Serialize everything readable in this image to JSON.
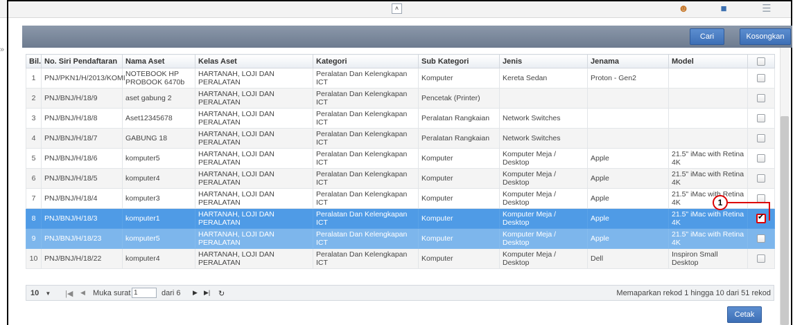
{
  "toolbar": {
    "collapse_icon": "chevrons-up-icon",
    "icons": [
      "user-settings-icon",
      "save-disk-icon",
      "list-view-icon",
      "exit-icon"
    ]
  },
  "search": {
    "cari_label": "Cari",
    "kosongkan_label": "Kosongkan"
  },
  "table": {
    "columns": [
      "Bil.",
      "No. Siri Pendaftaran",
      "Nama Aset",
      "Kelas Aset",
      "Kategori",
      "Sub Kategori",
      "Jenis",
      "Jenama",
      "Model"
    ],
    "rows": [
      {
        "bil": "1",
        "siri": "PNJ/PKN1/H/2013/KOMI",
        "nama": "NOTEBOOK HP PROBOOK 6470b",
        "kelas": "HARTANAH, LOJI DAN PERALATAN",
        "kategori": "Peralatan Dan Kelengkapan ICT",
        "sub": "Komputer",
        "jenis": "Kereta Sedan",
        "jenama": "Proton - Gen2",
        "model": "",
        "checked": false
      },
      {
        "bil": "2",
        "siri": "PNJ/BNJ/H/18/9",
        "nama": "aset gabung 2",
        "kelas": "HARTANAH, LOJI DAN PERALATAN",
        "kategori": "Peralatan Dan Kelengkapan ICT",
        "sub": "Pencetak (Printer)",
        "jenis": "",
        "jenama": "",
        "model": "",
        "checked": false
      },
      {
        "bil": "3",
        "siri": "PNJ/BNJ/H/18/8",
        "nama": "Aset12345678",
        "kelas": "HARTANAH, LOJI DAN PERALATAN",
        "kategori": "Peralatan Dan Kelengkapan ICT",
        "sub": "Peralatan Rangkaian",
        "jenis": "Network Switches",
        "jenama": "",
        "model": "",
        "checked": false
      },
      {
        "bil": "4",
        "siri": "PNJ/BNJ/H/18/7",
        "nama": "GABUNG 18",
        "kelas": "HARTANAH, LOJI DAN PERALATAN",
        "kategori": "Peralatan Dan Kelengkapan ICT",
        "sub": "Peralatan Rangkaian",
        "jenis": "Network Switches",
        "jenama": "",
        "model": "",
        "checked": false
      },
      {
        "bil": "5",
        "siri": "PNJ/BNJ/H/18/6",
        "nama": "komputer5",
        "kelas": "HARTANAH, LOJI DAN PERALATAN",
        "kategori": "Peralatan Dan Kelengkapan ICT",
        "sub": "Komputer",
        "jenis": "Komputer Meja / Desktop",
        "jenama": "Apple",
        "model": "21.5\" iMac with Retina 4K",
        "checked": false
      },
      {
        "bil": "6",
        "siri": "PNJ/BNJ/H/18/5",
        "nama": "komputer4",
        "kelas": "HARTANAH, LOJI DAN PERALATAN",
        "kategori": "Peralatan Dan Kelengkapan ICT",
        "sub": "Komputer",
        "jenis": "Komputer Meja / Desktop",
        "jenama": "Apple",
        "model": "21.5\" iMac with Retina 4K",
        "checked": false
      },
      {
        "bil": "7",
        "siri": "PNJ/BNJ/H/18/4",
        "nama": "komputer3",
        "kelas": "HARTANAH, LOJI DAN PERALATAN",
        "kategori": "Peralatan Dan Kelengkapan ICT",
        "sub": "Komputer",
        "jenis": "Komputer Meja / Desktop",
        "jenama": "Apple",
        "model": "21.5\" iMac with Retina 4K",
        "checked": false
      },
      {
        "bil": "8",
        "siri": "PNJ/BNJ/H/18/3",
        "nama": "komputer1",
        "kelas": "HARTANAH, LOJI DAN PERALATAN",
        "kategori": "Peralatan Dan Kelengkapan ICT",
        "sub": "Komputer",
        "jenis": "Komputer Meja / Desktop",
        "jenama": "Apple",
        "model": "21.5\" iMac with Retina 4K",
        "checked": true
      },
      {
        "bil": "9",
        "siri": "PNJ/BNJ/H/18/23",
        "nama": "komputer5",
        "kelas": "HARTANAH, LOJI DAN PERALATAN",
        "kategori": "Peralatan Dan Kelengkapan ICT",
        "sub": "Komputer",
        "jenis": "Komputer Meja / Desktop",
        "jenama": "Apple",
        "model": "21.5\" iMac with Retina 4K",
        "checked": false
      },
      {
        "bil": "10",
        "siri": "PNJ/BNJ/H/18/22",
        "nama": "komputer4",
        "kelas": "HARTANAH, LOJI DAN PERALATAN",
        "kategori": "Peralatan Dan Kelengkapan ICT",
        "sub": "Komputer",
        "jenis": "Komputer Meja / Desktop",
        "jenama": "Dell",
        "model": "Inspiron Small Desktop",
        "checked": false
      }
    ]
  },
  "pager": {
    "page_size": "10",
    "muka_surat_label": "Muka surat",
    "current_page": "1",
    "dari_label": "dari 6",
    "summary": "Memaparkan rekod 1 hingga 10 dari 51 rekod"
  },
  "footer": {
    "cetak_label": "Cetak"
  },
  "annotation": {
    "step": "1"
  },
  "colors": {
    "selected_row": "#4f9be6",
    "header_bar": "#7a889c",
    "button": "#4a7fc4",
    "annotation": "#dd0000"
  }
}
